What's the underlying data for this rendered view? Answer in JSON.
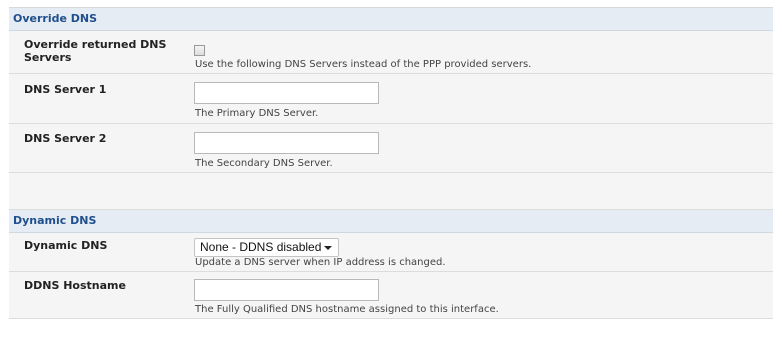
{
  "override": {
    "title": "Override DNS",
    "rows": [
      {
        "label": "Override returned DNS Servers",
        "hint": "Use the following DNS Servers instead of the PPP provided servers."
      },
      {
        "label": "DNS Server 1",
        "value": "",
        "hint": "The Primary DNS Server."
      },
      {
        "label": "DNS Server 2",
        "value": "",
        "hint": "The Secondary DNS Server."
      }
    ]
  },
  "dynamic": {
    "title": "Dynamic DNS",
    "rows": [
      {
        "label": "Dynamic DNS",
        "selected": "None - DDNS disabled",
        "hint": "Update a DNS server when IP address is changed."
      },
      {
        "label": "DDNS Hostname",
        "value": "",
        "hint": "The Fully Qualified DNS hostname assigned to this interface."
      }
    ]
  }
}
